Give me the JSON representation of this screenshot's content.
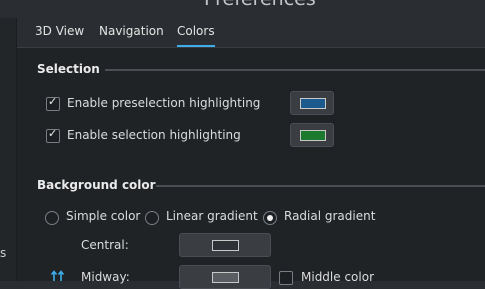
{
  "window": {
    "title": "Preferences"
  },
  "left_panel": {
    "partial_label": "s"
  },
  "tabs": [
    {
      "label": "3D View"
    },
    {
      "label": "Navigation"
    },
    {
      "label": "Colors"
    }
  ],
  "selection": {
    "header": "Selection",
    "preselection": {
      "label": "Enable preselection highlighting",
      "checked": true,
      "color": "#1c5a8e"
    },
    "selection": {
      "label": "Enable selection highlighting",
      "checked": true,
      "color": "#1c7a2e"
    }
  },
  "background": {
    "header": "Background color",
    "options": [
      {
        "label": "Simple color",
        "selected": false
      },
      {
        "label": "Linear gradient",
        "selected": false
      },
      {
        "label": "Radial gradient",
        "selected": true
      }
    ],
    "central": {
      "label": "Central:",
      "color": "#2e3236"
    },
    "midway": {
      "label": "Midway:",
      "color": "#5a5d61"
    },
    "middle_color": {
      "label": "Middle color",
      "checked": false
    }
  },
  "colors": {
    "accent": "#3daee9",
    "background": "#202326"
  }
}
